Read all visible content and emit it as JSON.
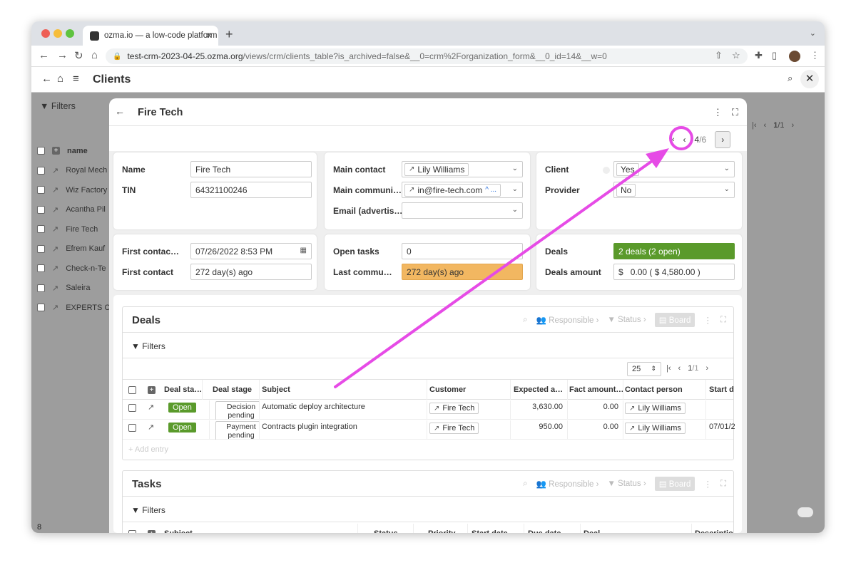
{
  "browser": {
    "tab_title": "ozma.io — a low-code platform",
    "url_host": "test-crm-2023-04-25.ozma.org",
    "url_path": "/views/crm/clients_table?is_archived=false&__0=crm%2Forganization_form&__0_id=14&__w=0"
  },
  "app": {
    "title": "Clients",
    "filters_label": "Filters",
    "column_name": "name",
    "rows": [
      "Royal Mech",
      "Wiz Factory",
      "Acantha Pil",
      "Fire Tech",
      "Efrem Kauf",
      "Check-n-Te",
      "Saleira",
      "EXPERTS CL"
    ],
    "page_current": "1",
    "page_total": "/1",
    "row_count": "8"
  },
  "modal": {
    "title": "Fire Tech",
    "pager": {
      "current": "4",
      "total": "/6"
    },
    "card1": {
      "name_label": "Name",
      "name_value": "Fire Tech",
      "tin_label": "TIN",
      "tin_value": "64321100246"
    },
    "card2": {
      "main_contact_label": "Main contact",
      "main_contact_value": "Lily Williams",
      "main_comm_label": "Main communi…",
      "main_comm_value": "in@fire-tech.com",
      "main_comm_extra": "^ ...",
      "email_label": "Email (advertis…",
      "email_value": ""
    },
    "card3": {
      "client_label": "Client",
      "client_value": "Yes",
      "provider_label": "Provider",
      "provider_value": "No"
    },
    "card4": {
      "first_contact_date_label": "First contac…",
      "first_contact_date_value": "07/26/2022 8:53 PM",
      "first_contact_label": "First contact",
      "first_contact_value": "272 day(s) ago"
    },
    "card5": {
      "open_tasks_label": "Open tasks",
      "open_tasks_value": "0",
      "last_comm_label": "Last commu…",
      "last_comm_value": "272 day(s) ago"
    },
    "card6": {
      "deals_label": "Deals",
      "deals_value": "2 deals (2 open)",
      "amount_label": "Deals amount",
      "amount_currency": "$",
      "amount_value": "0.00 ( $  4,580.00 )"
    },
    "deals": {
      "title": "Deals",
      "responsible": "Responsible",
      "status": "Status",
      "board": "Board",
      "filters": "Filters",
      "page_size": "25",
      "page": "1",
      "page_total": "/1",
      "add_entry": "Add entry",
      "columns": [
        "Deal sta…",
        "Deal stage",
        "Subject",
        "Customer",
        "Expected a…",
        "Fact amount…",
        "Contact person",
        "Start d"
      ],
      "rows": [
        {
          "status": "Open",
          "stage_line1": "Decision",
          "stage_line2": "pending",
          "subject": "Automatic deploy architecture",
          "customer": "Fire Tech",
          "expected": "3,630.00",
          "fact": "0.00",
          "contact": "Lily Williams",
          "start": ""
        },
        {
          "status": "Open",
          "stage_line1": "Payment",
          "stage_line2": "pending",
          "subject": "Contracts plugin integration",
          "customer": "Fire Tech",
          "expected": "950.00",
          "fact": "0.00",
          "contact": "Lily Williams",
          "start": "07/01/2"
        }
      ]
    },
    "tasks": {
      "title": "Tasks",
      "responsible": "Responsible",
      "status": "Status",
      "board": "Board",
      "filters": "Filters",
      "columns": [
        "Subject",
        "Status",
        "Priority",
        "Start date",
        "Due date",
        "Deal",
        "Descriptio"
      ]
    }
  },
  "annotation": {
    "color": "#e64be6"
  }
}
